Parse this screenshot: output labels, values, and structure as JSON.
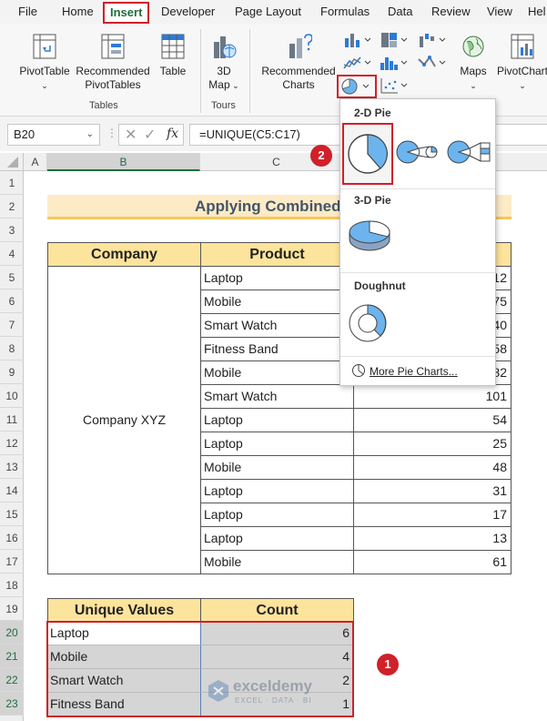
{
  "menu": {
    "items": [
      "File",
      "Home",
      "Insert",
      "Developer",
      "Page Layout",
      "Formulas",
      "Data",
      "Review",
      "View",
      "Hel"
    ],
    "active": "Insert"
  },
  "ribbon": {
    "pivottable": "PivotTable",
    "recommended_pivottables": [
      "Recommended",
      "PivotTables"
    ],
    "table": "Table",
    "tables_group": "Tables",
    "map3d": [
      "3D",
      "Map"
    ],
    "tours_group": "Tours",
    "recommended_charts": [
      "Recommended",
      "Charts"
    ],
    "maps": "Maps",
    "pivotchart": "PivotChart"
  },
  "formula_bar": {
    "name_box": "B20",
    "fx": "fx",
    "formula": "=UNIQUE(C5:C17)"
  },
  "columns": [
    "A",
    "B",
    "C"
  ],
  "rows": [
    "1",
    "2",
    "3",
    "4",
    "5",
    "6",
    "7",
    "8",
    "9",
    "10",
    "11",
    "12",
    "13",
    "14",
    "15",
    "16",
    "17",
    "18",
    "19",
    "20",
    "21",
    "22",
    "23"
  ],
  "sheet": {
    "title": "Applying Combined Fu",
    "headers": {
      "company": "Company",
      "product": "Product"
    },
    "company_name": "Company XYZ",
    "products": [
      "Laptop",
      "Mobile",
      "Smart Watch",
      "Fitness Band",
      "Mobile",
      "Smart Watch",
      "Laptop",
      "Laptop",
      "Mobile",
      "Laptop",
      "Laptop",
      "Laptop",
      "Mobile"
    ],
    "values": [
      "12",
      "75",
      "40",
      "58",
      "82",
      "101",
      "54",
      "25",
      "48",
      "31",
      "17",
      "13",
      "61"
    ],
    "unique": {
      "headers": {
        "values": "Unique Values",
        "count": "Count"
      },
      "rows": [
        {
          "value": "Laptop",
          "count": "6"
        },
        {
          "value": "Mobile",
          "count": "4"
        },
        {
          "value": "Smart Watch",
          "count": "2"
        },
        {
          "value": "Fitness Band",
          "count": "1"
        }
      ]
    }
  },
  "pie_menu": {
    "section_2d": "2-D Pie",
    "section_3d": "3-D Pie",
    "section_doughnut": "Doughnut",
    "more": "More Pie Charts..."
  },
  "badges": {
    "one": "1",
    "two": "2"
  },
  "watermark": {
    "name": "exceldemy",
    "tagline": "EXCEL · DATA · BI"
  },
  "colors": {
    "accent": "#1e6f3c",
    "highlight": "#d0202a",
    "header_fill": "#fde49c",
    "pie_blue": "#6cb4ee"
  }
}
